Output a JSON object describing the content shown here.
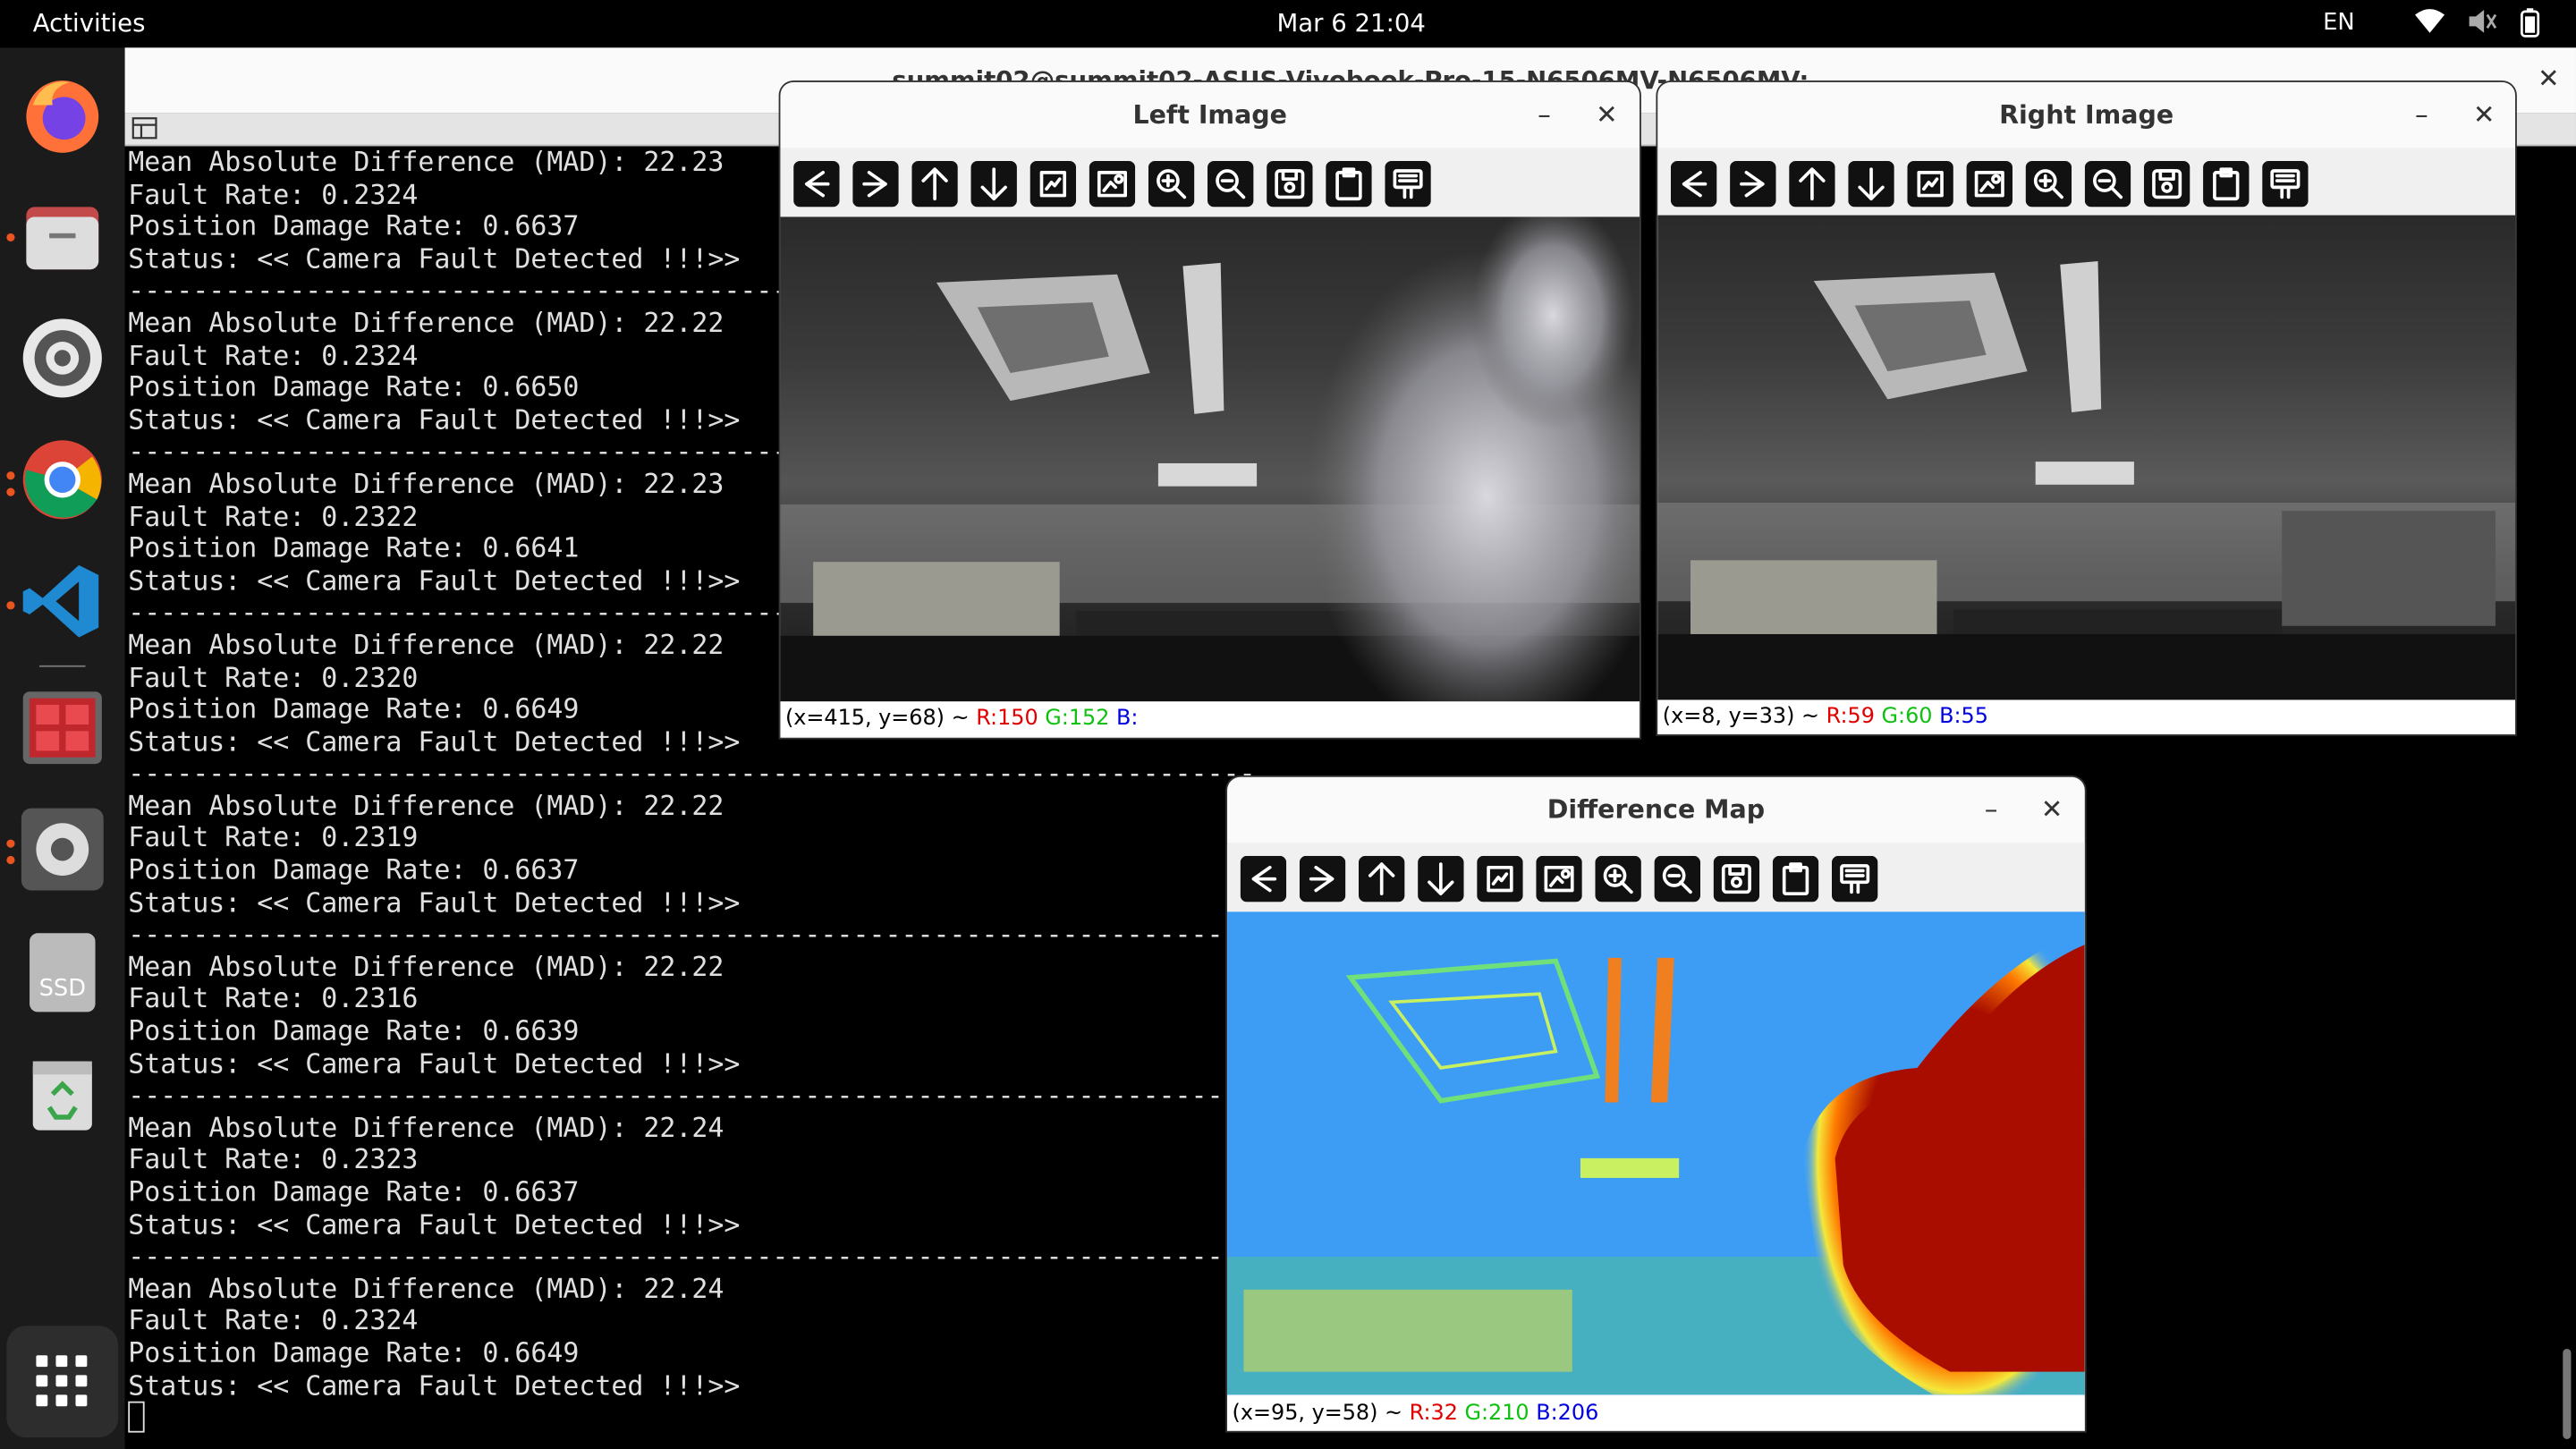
{
  "topbar": {
    "activities": "Activities",
    "clock": "Mar 6  21:04",
    "language": "EN"
  },
  "dock": {
    "items": [
      {
        "name": "firefox-icon"
      },
      {
        "name": "files-icon"
      },
      {
        "name": "settings-gear-icon"
      },
      {
        "name": "chrome-icon"
      },
      {
        "name": "vscode-icon"
      },
      {
        "name": "app-grid-red-icon"
      },
      {
        "name": "system-settings-icon"
      },
      {
        "name": "ssd-drive-icon",
        "label": "SSD"
      },
      {
        "name": "trash-icon"
      },
      {
        "name": "show-apps-icon"
      }
    ]
  },
  "terminal": {
    "title": "summit02@summit02-ASUS-Vivobook-Pro-15-N6506MV-N6506MV:",
    "entries": [
      {
        "mad": "Mean Absolute Difference (MAD): 22.23",
        "fault": "Fault Rate: 0.2324",
        "damage": "Position Damage Rate: 0.6637",
        "status": "Status: << Camera Fault Detected !!!>>"
      },
      {
        "mad": "Mean Absolute Difference (MAD): 22.22",
        "fault": "Fault Rate: 0.2324",
        "damage": "Position Damage Rate: 0.6650",
        "status": "Status: << Camera Fault Detected !!!>>"
      },
      {
        "mad": "Mean Absolute Difference (MAD): 22.23",
        "fault": "Fault Rate: 0.2322",
        "damage": "Position Damage Rate: 0.6641",
        "status": "Status: << Camera Fault Detected !!!>>"
      },
      {
        "mad": "Mean Absolute Difference (MAD): 22.22",
        "fault": "Fault Rate: 0.2320",
        "damage": "Position Damage Rate: 0.6649",
        "status": "Status: << Camera Fault Detected !!!>>"
      },
      {
        "mad": "Mean Absolute Difference (MAD): 22.22",
        "fault": "Fault Rate: 0.2319",
        "damage": "Position Damage Rate: 0.6637",
        "status": "Status: << Camera Fault Detected !!!>>"
      },
      {
        "mad": "Mean Absolute Difference (MAD): 22.22",
        "fault": "Fault Rate: 0.2316",
        "damage": "Position Damage Rate: 0.6639",
        "status": "Status: << Camera Fault Detected !!!>>"
      },
      {
        "mad": "Mean Absolute Difference (MAD): 22.24",
        "fault": "Fault Rate: 0.2323",
        "damage": "Position Damage Rate: 0.6637",
        "status": "Status: << Camera Fault Detected !!!>>"
      },
      {
        "mad": "Mean Absolute Difference (MAD): 22.24",
        "fault": "Fault Rate: 0.2324",
        "damage": "Position Damage Rate: 0.6649",
        "status": "Status: << Camera Fault Detected !!!>>"
      }
    ],
    "separator": "----------------------------------------------------------------------"
  },
  "windows": {
    "left": {
      "title": "Left Image",
      "status": {
        "coords": "(x=415, y=68) ~ ",
        "r": "R:150",
        "g": "G:152",
        "b": "B:"
      }
    },
    "right": {
      "title": "Right Image",
      "status": {
        "coords": "(x=8, y=33) ~ ",
        "r": "R:59",
        "g": "G:60",
        "b": "B:55"
      }
    },
    "diff": {
      "title": "Difference Map",
      "status": {
        "coords": "(x=95, y=58) ~ ",
        "r": "R:32",
        "g": "G:210",
        "b": "B:206"
      }
    },
    "toolbar_tools": [
      "pan-left-icon",
      "pan-right-icon",
      "pan-up-icon",
      "pan-down-icon",
      "zoom-fit-icon",
      "zoom-original-icon",
      "zoom-in-icon",
      "zoom-out-icon",
      "save-icon",
      "copy-clipboard-icon",
      "properties-icon"
    ]
  }
}
